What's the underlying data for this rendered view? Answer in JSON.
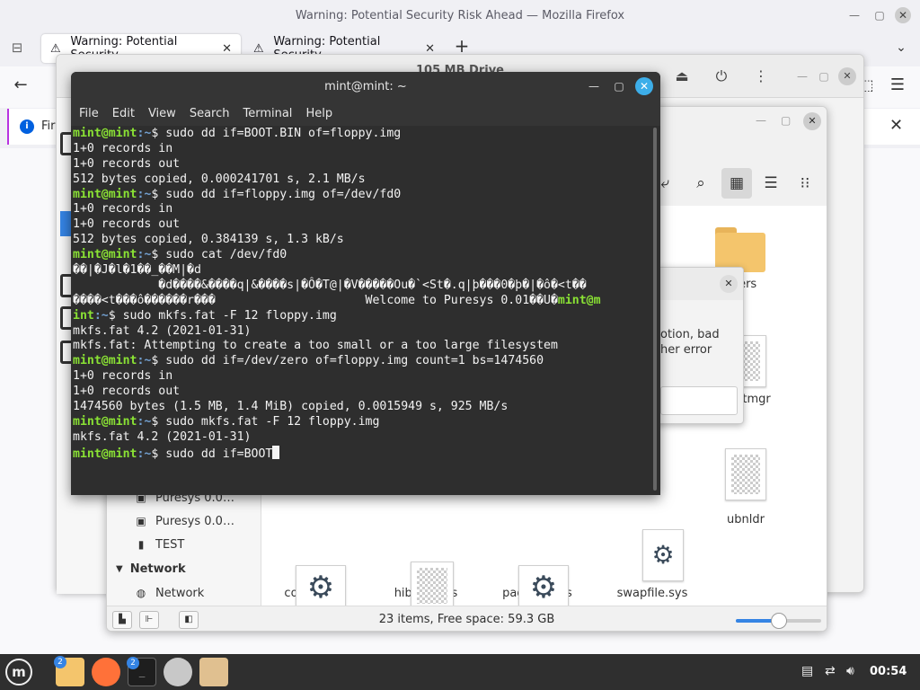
{
  "firefox": {
    "window_title": "Warning: Potential Security Risk Ahead — Mozilla Firefox",
    "tabs": [
      {
        "label": "Warning: Potential Security"
      },
      {
        "label": "Warning: Potential Security"
      }
    ],
    "infobar_text": "Fir"
  },
  "disks": {
    "title": "105 MB Drive"
  },
  "dialog": {
    "message_line1": "otion, bad",
    "message_line2": "her error"
  },
  "terminal": {
    "title": "mint@mint: ~",
    "menu": [
      "File",
      "Edit",
      "View",
      "Search",
      "Terminal",
      "Help"
    ],
    "lines": [
      {
        "user": "mint@mint",
        "path": ":~",
        "text": "$ sudo dd if=BOOT.BIN of=floppy.img"
      },
      {
        "text": "1+0 records in"
      },
      {
        "text": "1+0 records out"
      },
      {
        "text": "512 bytes copied, 0.000241701 s, 2.1 MB/s"
      },
      {
        "user": "mint@mint",
        "path": ":~",
        "text": "$ sudo dd if=floppy.img of=/dev/fd0"
      },
      {
        "text": "1+0 records in"
      },
      {
        "text": "1+0 records out"
      },
      {
        "text": "512 bytes copied, 0.384139 s, 1.3 kB/s"
      },
      {
        "user": "mint@mint",
        "path": ":~",
        "text": "$ sudo cat /dev/fd0"
      },
      {
        "text": "��|�J�l�1��_��M|�d"
      },
      {
        "text": "            �d����&����q|&����s|�Ô�T@|�V�����Ou�`<St�.q|þ���0�þ�|�ô�<t��"
      },
      {
        "text": "����<t���ô������r���                     Welcome to Puresys 0.01��U�",
        "tail_user": "mint@m"
      },
      {
        "user": "int",
        "path": ":~",
        "text": "$ sudo mkfs.fat -F 12 floppy.img"
      },
      {
        "text": "mkfs.fat 4.2 (2021-01-31)"
      },
      {
        "text": "mkfs.fat: Attempting to create a too small or a too large filesystem"
      },
      {
        "user": "mint@mint",
        "path": ":~",
        "text": "$ sudo dd if=/dev/zero of=floppy.img count=1 bs=1474560"
      },
      {
        "text": "1+0 records in"
      },
      {
        "text": "1+0 records out"
      },
      {
        "text": "1474560 bytes (1.5 MB, 1.4 MiB) copied, 0.0015949 s, 925 MB/s"
      },
      {
        "user": "mint@mint",
        "path": ":~",
        "text": "$ sudo mkfs.fat -F 12 floppy.img"
      },
      {
        "text": "mkfs.fat 4.2 (2021-01-31)"
      },
      {
        "user": "mint@mint",
        "path": ":~",
        "text": "$ sudo dd if=BOOT",
        "cursor": true
      }
    ]
  },
  "nemo": {
    "sidebar": [
      {
        "type": "item",
        "icon": "drive-icon",
        "label": "Puresys 0.0…"
      },
      {
        "type": "item",
        "icon": "drive-icon",
        "label": "Puresys 0.0…"
      },
      {
        "type": "item",
        "icon": "usb-icon",
        "label": "TEST"
      },
      {
        "type": "header",
        "label": "Network"
      },
      {
        "type": "item",
        "icon": "globe-icon",
        "label": "Network"
      }
    ],
    "files": [
      {
        "name": "Users",
        "kind": "folder"
      },
      {
        "name": "bootmgr",
        "kind": "doc"
      },
      {
        "name": "config.sys",
        "kind": "doc"
      },
      {
        "name": "hiberfil.sys",
        "kind": "doc"
      },
      {
        "name": "pagefile.sys",
        "kind": "doc"
      },
      {
        "name": "swapfile.sys",
        "kind": "gear"
      },
      {
        "name": "ubnldr",
        "kind": "doc"
      }
    ],
    "status_text": "23 items, Free space: 59.3 GB",
    "zoom_level": 0.5
  },
  "taskbar": {
    "time": "00:54",
    "badges": {
      "files": "2",
      "terminal": "2"
    }
  },
  "colors": {
    "terminal_bg": "#2e2e2e",
    "prompt_user": "#8ae234",
    "prompt_path": "#729fcf",
    "accent": "#3584e4",
    "folder": "#f4c56c"
  }
}
